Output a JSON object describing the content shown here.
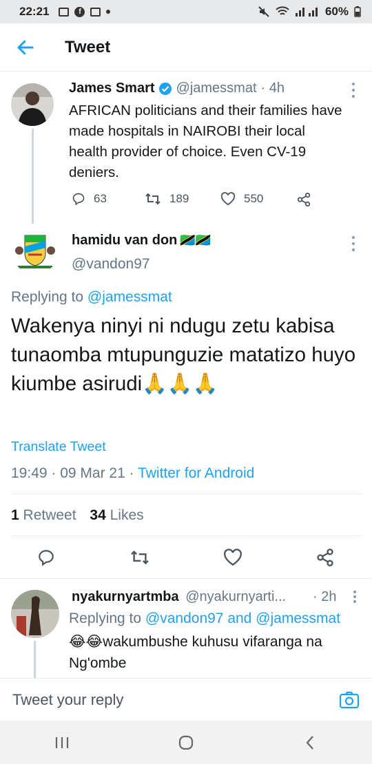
{
  "status_bar": {
    "time": "22:21",
    "battery": "60%",
    "icons": [
      "gallery-icon",
      "facebook-icon",
      "sim-icon",
      "mute-icon",
      "wifi-icon",
      "signal-icon",
      "battery-icon"
    ]
  },
  "header": {
    "title": "Tweet",
    "back_icon": "arrow-left-icon"
  },
  "parent_tweet": {
    "author": "James Smart",
    "handle": "@jamessmat",
    "time": "· 4h",
    "verified": true,
    "text": "AFRICAN politicians and their families have made hospitals in NAIROBI their local health provider of choice. Even CV-19 deniers.",
    "replies": "63",
    "retweets": "189",
    "likes": "550"
  },
  "main_tweet": {
    "author": "hamidu van don",
    "author_flags": "🇹🇿🇹🇿",
    "handle": "@vandon97",
    "replying_prefix": "Replying to",
    "replying_handle": "@jamessmat",
    "text": "Wakenya ninyi ni ndugu zetu kabisa tunaomba mtupunguzie matatizo huyo kiumbe asirudi🙏🙏🙏",
    "translate_label": "Translate Tweet",
    "timestamp": "19:49 · 09 Mar 21 · ",
    "client": "Twitter for Android",
    "retweet_count": "1",
    "retweet_label": "Retweet",
    "like_count": "34",
    "like_label": "Likes"
  },
  "reply_tweet": {
    "author": "nyakurnyartmba",
    "handle": "@nyakurnyarti...",
    "time": "· 2h",
    "replying_prefix": "Replying to",
    "replying_handles": "@vandon97 and @jamessmat",
    "text": "😂😂wakumbushe kuhusu vifaranga na Ng'ombe"
  },
  "reply_composer": {
    "placeholder": "Tweet your reply"
  },
  "colors": {
    "accent": "#1da1f2",
    "text": "#14171a",
    "muted": "#657786"
  }
}
